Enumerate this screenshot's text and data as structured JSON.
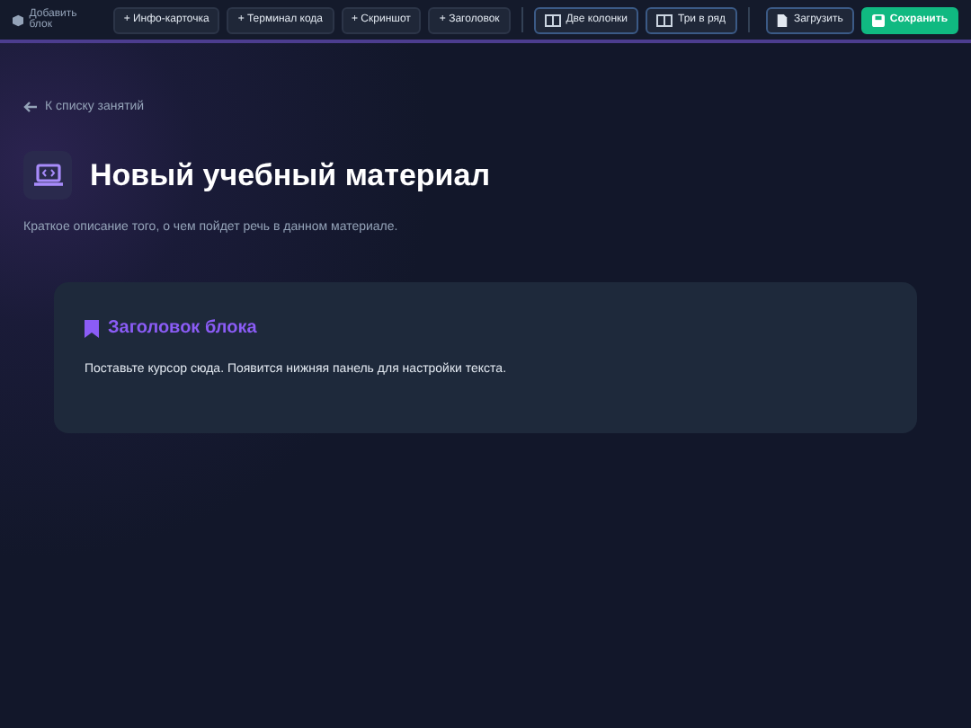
{
  "toolbar": {
    "add_label": "Добавить блок",
    "block_buttons": [
      "+ Инфо-карточка",
      "+ Терминал кода",
      "+ Скриншот",
      "+ Заголовок"
    ],
    "layout_buttons": [
      "Две колонки",
      "Три в ряд"
    ],
    "upload": "Загрузить",
    "save": "Сохранить"
  },
  "back_link": "К списку занятий",
  "title": "Новый учебный материал",
  "description": "Краткое описание того, о чем пойдет речь в данном материале.",
  "block": {
    "heading": "Заголовок блока",
    "text": "Поставьте курсор сюда. Появится нижняя панель для настройки текста."
  }
}
